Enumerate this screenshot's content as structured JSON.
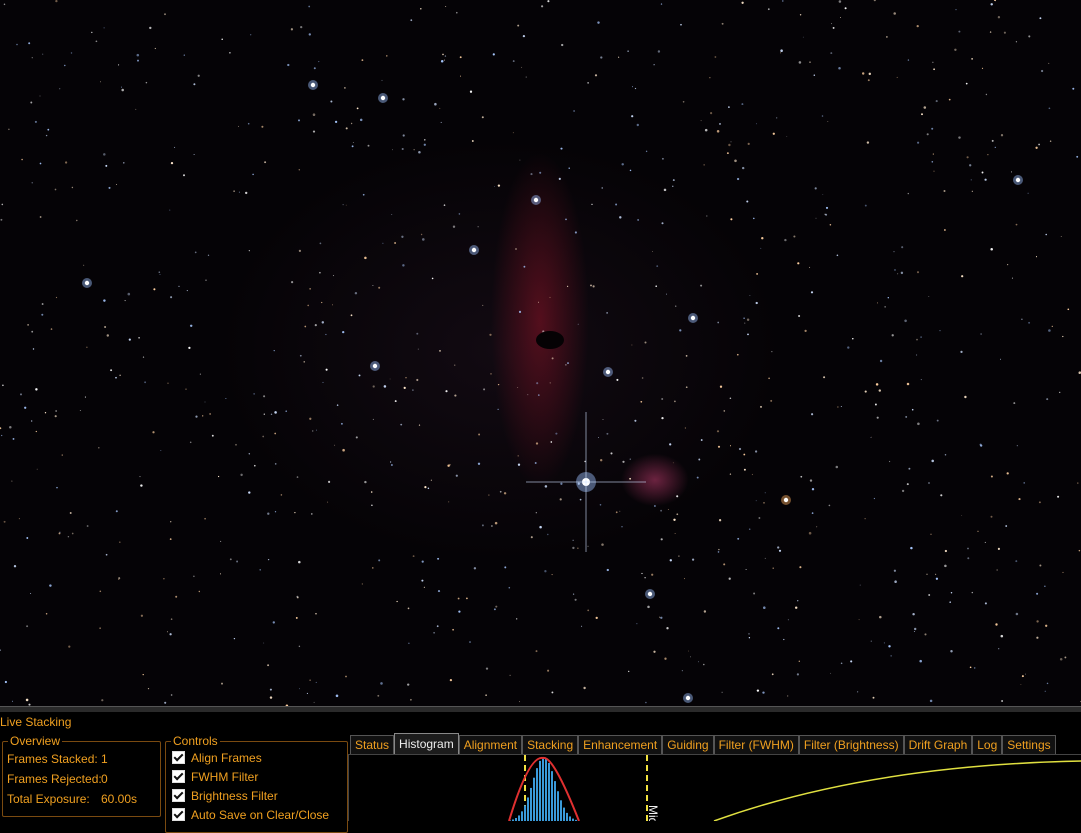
{
  "panel": {
    "title": "Live Stacking",
    "overview": {
      "legend": "Overview",
      "frames_stacked_label": "Frames Stacked:",
      "frames_stacked_value": "1",
      "frames_rejected_label": "Frames Rejected:",
      "frames_rejected_value": "0",
      "total_exposure_label": "Total Exposure:",
      "total_exposure_value": "60.00s"
    },
    "controls": {
      "legend": "Controls",
      "align_frames": "Align Frames",
      "fwhm_filter": "FWHM Filter",
      "brightness_filter": "Brightness Filter",
      "auto_save": "Auto Save on Clear/Close"
    },
    "tabs": [
      "Status",
      "Histogram",
      "Alignment",
      "Stacking",
      "Enhancement",
      "Guiding",
      "Filter (FWHM)",
      "Filter (Brightness)",
      "Drift Graph",
      "Log",
      "Settings"
    ],
    "active_tab": "Histogram",
    "histogram": {
      "marker_label": "Mid"
    }
  },
  "colors": {
    "accent": "#f0a020",
    "histogram_blue": "#3a9ad9",
    "histogram_red": "#e03030",
    "marker_yellow": "#f0e040"
  }
}
